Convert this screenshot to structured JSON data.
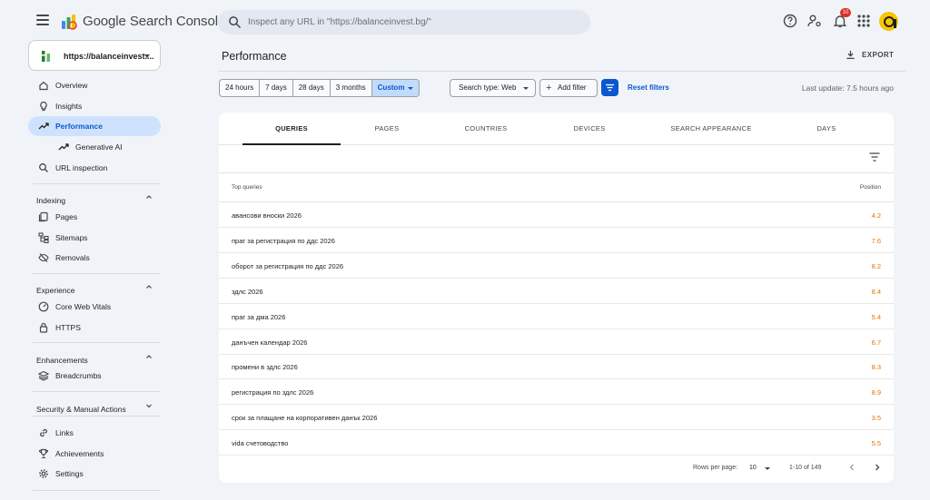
{
  "app": {
    "title": "Google Search Console"
  },
  "search": {
    "placeholder": "Inspect any URL in \"https://balanceinvest.bg/\""
  },
  "header": {
    "notification_count": "10"
  },
  "property": {
    "url": "https://balanceinvest...."
  },
  "sidebar": {
    "top_items": [
      {
        "label": "Overview",
        "icon": "home-icon"
      },
      {
        "label": "Insights",
        "icon": "lightbulb-icon"
      },
      {
        "label": "Performance",
        "icon": "trending-up-icon",
        "active": true
      },
      {
        "label": "Generative AI",
        "icon": "trending-up-icon",
        "sub": true
      },
      {
        "label": "URL inspection",
        "icon": "search-icon"
      }
    ],
    "sections": [
      {
        "title": "Indexing",
        "items": [
          {
            "label": "Pages",
            "icon": "pages-icon"
          },
          {
            "label": "Sitemaps",
            "icon": "sitemap-icon"
          },
          {
            "label": "Removals",
            "icon": "eye-off-icon"
          }
        ]
      },
      {
        "title": "Experience",
        "items": [
          {
            "label": "Core Web Vitals",
            "icon": "gauge-icon"
          },
          {
            "label": "HTTPS",
            "icon": "lock-icon"
          }
        ]
      },
      {
        "title": "Enhancements",
        "items": [
          {
            "label": "Breadcrumbs",
            "icon": "layers-icon"
          }
        ]
      },
      {
        "title": "Security & Manual Actions",
        "items": []
      }
    ],
    "bottom_items": [
      {
        "label": "Links",
        "icon": "link-icon"
      },
      {
        "label": "Achievements",
        "icon": "trophy-icon"
      },
      {
        "label": "Settings",
        "icon": "gear-icon"
      }
    ]
  },
  "main": {
    "title": "Performance",
    "export_label": "EXPORT",
    "date_ranges": [
      "24 hours",
      "7 days",
      "28 days",
      "3 months",
      "Custom"
    ],
    "selected_range": "Custom",
    "search_type": "Search type: Web",
    "add_filter": "Add filter",
    "reset_filters": "Reset filters",
    "last_update": "Last update: 7.5 hours ago"
  },
  "tabs": [
    "QUERIES",
    "PAGES",
    "COUNTRIES",
    "DEVICES",
    "SEARCH APPEARANCE",
    "DAYS"
  ],
  "table": {
    "headers": {
      "query": "Top queries",
      "position": "Position"
    },
    "rows": [
      {
        "query": "авансови вноски 2026",
        "position": "4.2"
      },
      {
        "query": "праг за регистрация по ддс 2026",
        "position": "7.6"
      },
      {
        "query": "оборот за регистрация по ддс 2026",
        "position": "8.2"
      },
      {
        "query": "здлс 2026",
        "position": "8.4"
      },
      {
        "query": "праг за дма 2026",
        "position": "5.4"
      },
      {
        "query": "данъчен календар 2026",
        "position": "6.7"
      },
      {
        "query": "промени в здлс 2026",
        "position": "8.3"
      },
      {
        "query": "регистрация по здлс 2026",
        "position": "8.9"
      },
      {
        "query": "срок за плащане на корпоративен данък 2026",
        "position": "3.5"
      },
      {
        "query": "vida счетоводство",
        "position": "5.5"
      }
    ]
  },
  "pagination": {
    "rows_per_page_label": "Rows per page:",
    "rows_per_page": "10",
    "range": "1-10 of 149"
  },
  "colors": {
    "accent": "#0b57d0",
    "position_value": "#e37400",
    "active_nav": "#cfe2fd"
  }
}
